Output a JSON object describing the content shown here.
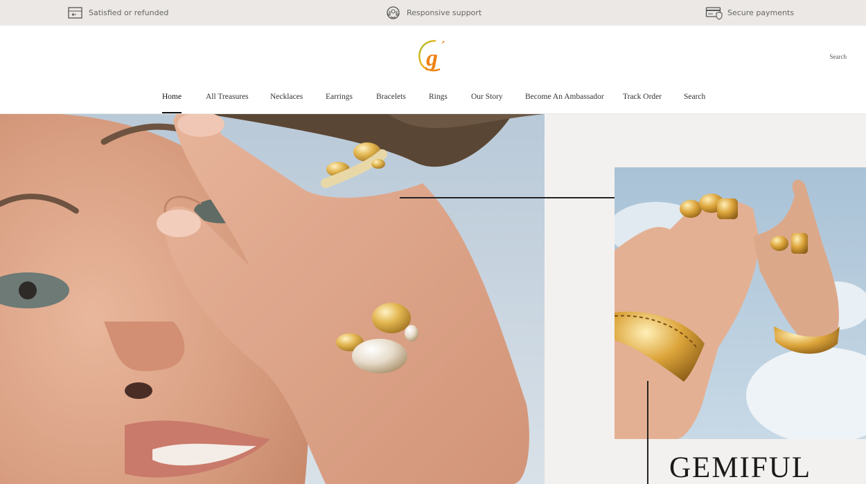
{
  "topbar": {
    "benefits": [
      {
        "icon": "refund-box-icon",
        "label": "Satisfied or refunded"
      },
      {
        "icon": "support-headset-icon",
        "label": "Responsive support"
      },
      {
        "icon": "secure-card-icon",
        "label": "Secure payments"
      }
    ]
  },
  "header": {
    "logo_alt": "g",
    "search_label": "Search",
    "nav": [
      {
        "label": "Home",
        "active": true
      },
      {
        "label": "All Treasures"
      },
      {
        "label": "Necklaces"
      },
      {
        "label": "Earrings"
      },
      {
        "label": "Bracelets"
      },
      {
        "label": "Rings"
      },
      {
        "label": "Our Story"
      },
      {
        "label": "Become An Ambassador"
      },
      {
        "label": "Track Order"
      },
      {
        "label": "Search"
      }
    ]
  },
  "hero": {
    "title": "GEMIFUL"
  },
  "colors": {
    "topbar_bg": "#ebe8e5",
    "logo_orange": "#f08a1c",
    "logo_green": "#9bc12a",
    "gold": "#d8a93f"
  }
}
